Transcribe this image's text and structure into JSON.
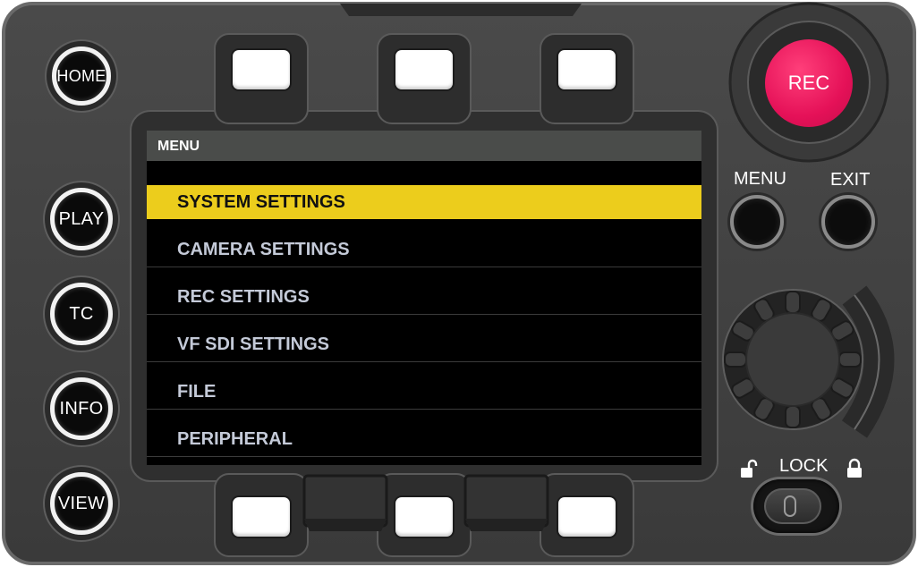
{
  "side_buttons": [
    "HOME",
    "PLAY",
    "TC",
    "INFO",
    "VIEW"
  ],
  "lcd": {
    "header": "MENU",
    "items": [
      "SYSTEM SETTINGS",
      "CAMERA SETTINGS",
      "REC SETTINGS",
      "VF SDI SETTINGS",
      "FILE",
      "PERIPHERAL"
    ],
    "selected_index": 0
  },
  "rec_button": "REC",
  "menu_button_label": "MENU",
  "exit_button_label": "EXIT",
  "lock_label": "LOCK",
  "colors": {
    "rec": "#e51158",
    "selection": "#eccd1c",
    "menu_text": "#c4cad8",
    "panel": "#444444"
  }
}
